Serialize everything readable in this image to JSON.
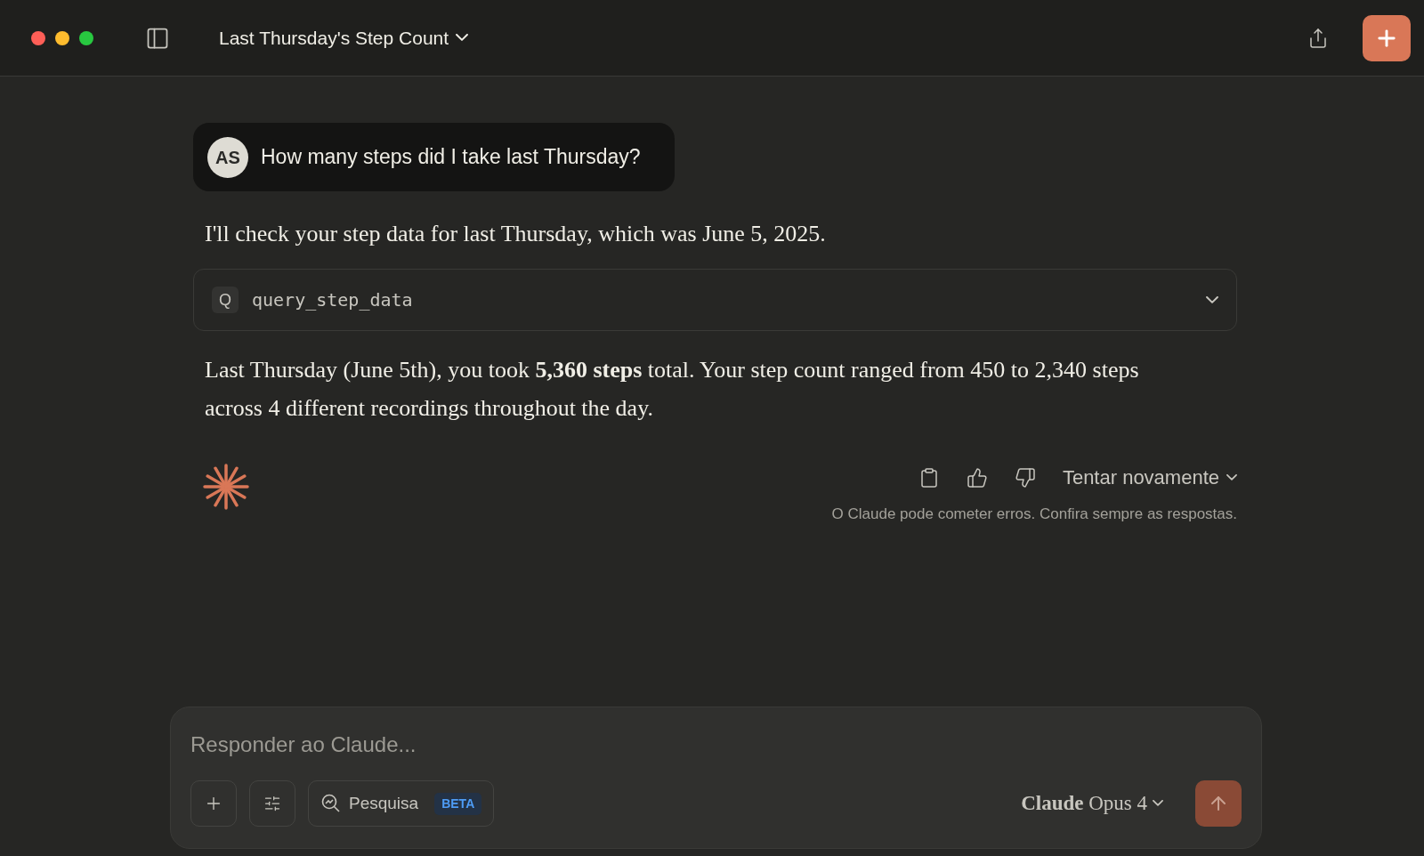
{
  "window": {
    "title": "Last Thursday's Step Count"
  },
  "user_message": {
    "avatar": "AS",
    "text": "How many steps did I take last Thursday?"
  },
  "assistant_intro": "I'll check your step data for last Thursday, which was June 5, 2025.",
  "tool_call": {
    "badge": "Q",
    "name": "query_step_data",
    "expanded": false
  },
  "assistant_answer": "Last Thursday (June 5th), you took **5,360 steps** total. Your step count ranged from 450 to 2,340 steps across 4 different recordings throughout the day.",
  "actions": {
    "retry": "Tentar novamente",
    "disclaimer": "O Claude pode cometer erros. Confira sempre as respostas."
  },
  "composer": {
    "placeholder": "Responder ao Claude...",
    "research": {
      "label": "Pesquisa",
      "badge": "BETA"
    },
    "model": "**Claude** Opus 4",
    "send_disabled": true
  }
}
